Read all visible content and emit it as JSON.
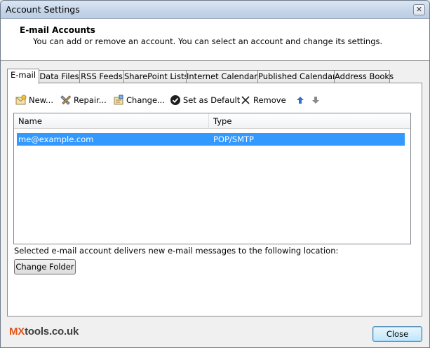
{
  "window": {
    "title": "Account Settings",
    "close_glyph": "✕"
  },
  "header": {
    "title": "E-mail Accounts",
    "subtitle": "You can add or remove an account. You can select an account and change its settings."
  },
  "tabs": [
    {
      "label": "E-mail",
      "active": true
    },
    {
      "label": "Data Files",
      "active": false
    },
    {
      "label": "RSS Feeds",
      "active": false
    },
    {
      "label": "SharePoint Lists",
      "active": false
    },
    {
      "label": "Internet Calendars",
      "active": false
    },
    {
      "label": "Published Calendars",
      "active": false
    },
    {
      "label": "Address Books",
      "active": false
    }
  ],
  "toolbar": {
    "new_label": "New...",
    "repair_label": "Repair...",
    "change_label": "Change...",
    "default_label": "Set as Default",
    "remove_label": "Remove"
  },
  "list": {
    "columns": [
      "Name",
      "Type"
    ],
    "rows": [
      {
        "name": "me@example.com",
        "type": "POP/SMTP",
        "selected": true
      }
    ]
  },
  "delivery": {
    "text": "Selected e-mail account delivers new e-mail messages to the following location:",
    "change_folder_label": "Change Folder"
  },
  "footer": {
    "logo_prefix": "MX",
    "logo_rest": "tools.co.uk",
    "close_label": "Close"
  },
  "colors": {
    "selection": "#3399ff",
    "logo_accent": "#e4541b",
    "arrow_up": "#2f6fc9",
    "arrow_down": "#8a8a8a"
  }
}
